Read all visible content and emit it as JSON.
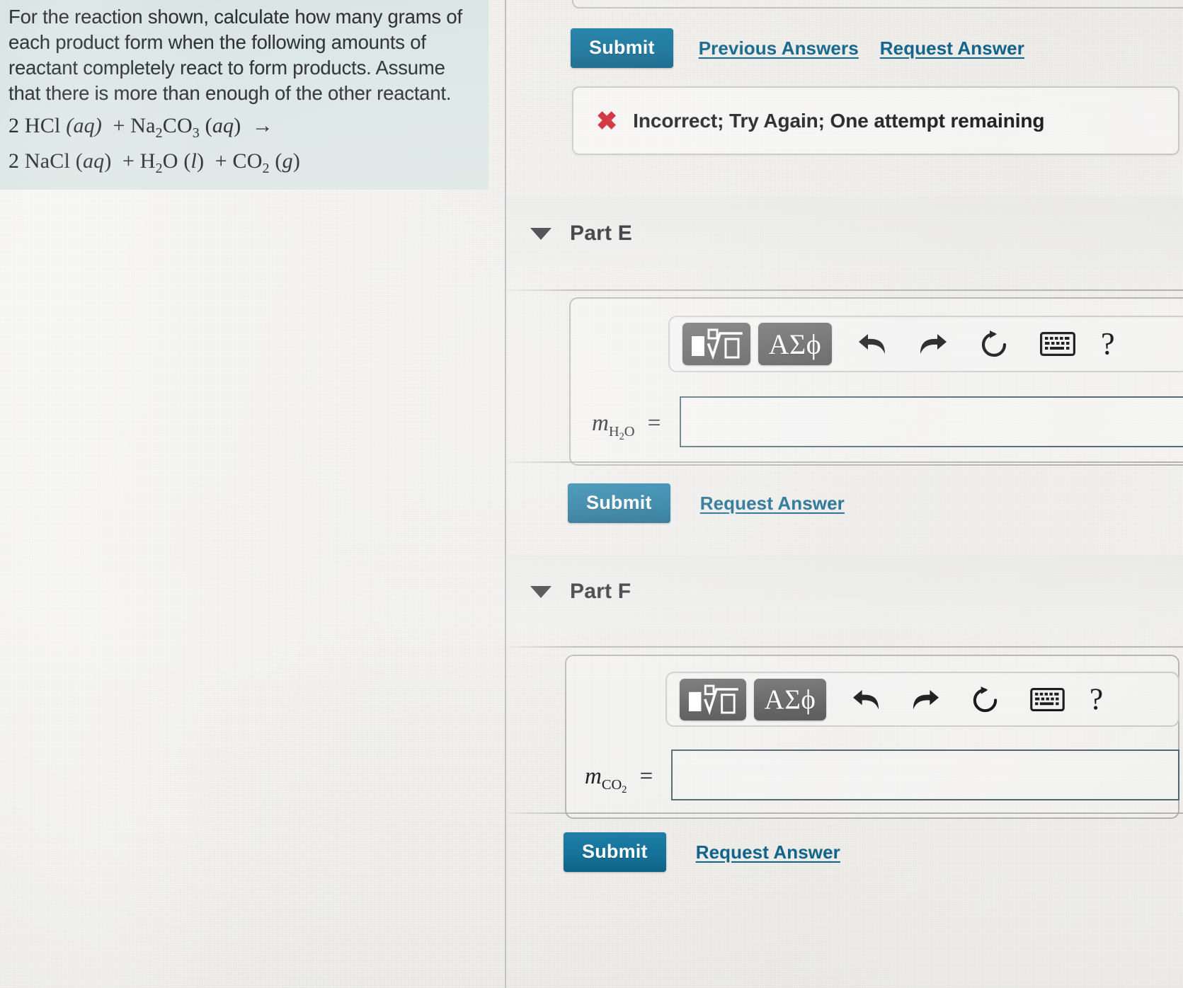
{
  "problem": {
    "prompt": "For the reaction shown, calculate how many grams of each product form when the following amounts of reactant completely react to form products. Assume that there is more than enough of the other reactant.",
    "equation_line1_prefix": "2 HCl",
    "equation": {
      "reactant_coeff_hcl": "2",
      "hcl": "HCl",
      "hcl_state": "(aq)",
      "plus1": "+",
      "na2co3": "Na2CO3",
      "na2co3_state": "(aq)",
      "arrow": "→",
      "nacl_coeff": "2",
      "nacl": "NaCl",
      "nacl_state": "(aq)",
      "plus2": "+",
      "h2o": "H2O",
      "h2o_state": "(l)",
      "plus3": "+",
      "co2": "CO2",
      "co2_state": "(g)"
    }
  },
  "top_actions": {
    "submit_label": "Submit",
    "previous_answers_label": "Previous Answers",
    "request_answer_label": "Request Answer"
  },
  "feedback": {
    "icon": "x-mark-icon",
    "message": "Incorrect; Try Again; One attempt remaining",
    "icon_glyph": "✖",
    "color": "#cf1f2e"
  },
  "math_toolbar": {
    "template_key_label": "sqrt-template-icon",
    "greek_key_label": "ΑΣϕ",
    "undo_label": "undo-icon",
    "redo_label": "redo-icon",
    "reset_label": "reset-icon",
    "keyboard_label": "keyboard-icon",
    "help_label": "?"
  },
  "parts": [
    {
      "id": "part-e",
      "title": "Part E",
      "caret": "caret-down-icon",
      "variable_m": "m",
      "variable_sub": "H2O",
      "variable_equals": "=",
      "input_value": "",
      "input_placeholder": "",
      "submit_label": "Submit",
      "request_answer_label": "Request Answer"
    },
    {
      "id": "part-f",
      "title": "Part F",
      "caret": "caret-down-icon",
      "variable_m": "m",
      "variable_sub": "CO2",
      "variable_equals": "=",
      "input_value": "",
      "input_placeholder": "",
      "submit_label": "Submit",
      "request_answer_label": "Request Answer"
    }
  ],
  "theme": {
    "accent": "#15729a",
    "link": "#11658c",
    "error": "#cf1f2e",
    "problem_bg": "#dbe6e4",
    "key_bg": "#5f5f5f",
    "input_border": "#536871"
  }
}
